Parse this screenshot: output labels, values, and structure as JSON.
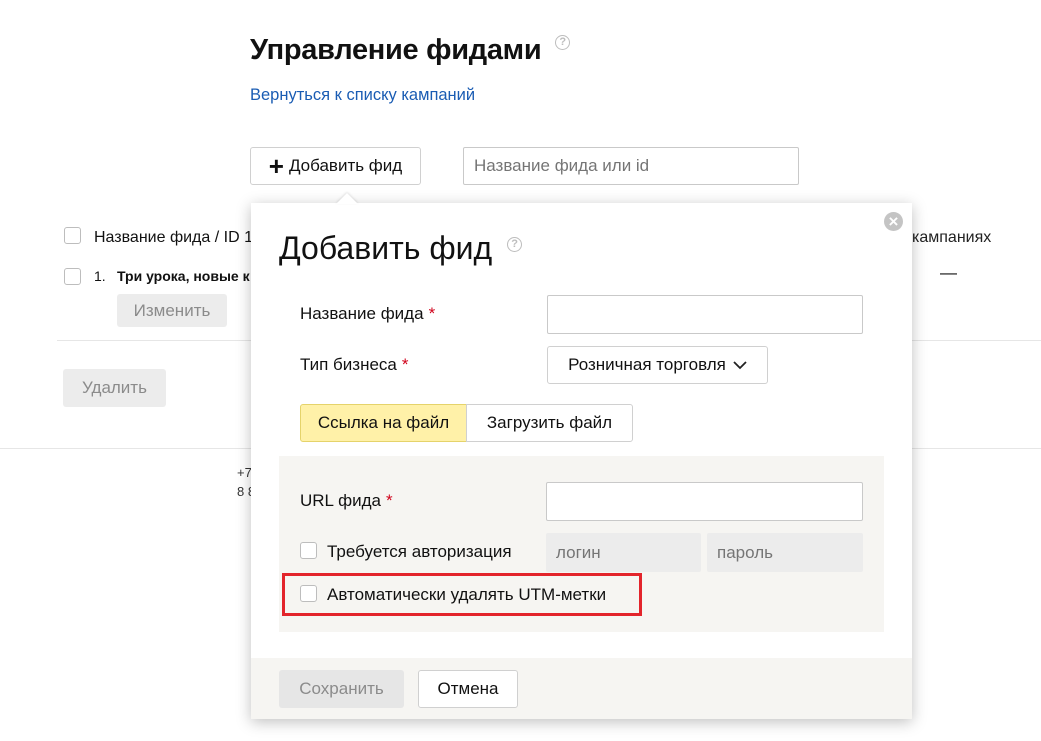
{
  "header": {
    "title": "Управление фидами",
    "help_icon": "?",
    "back_link": "Вернуться к списку кампаний"
  },
  "toolbar": {
    "add_feed_icon": "+",
    "add_feed_label": "Добавить фид",
    "search_placeholder": "Название фида или id"
  },
  "table": {
    "columns": [
      "Название фида / ID 1",
      "кампаниях"
    ],
    "rows": [
      {
        "number": "1.",
        "name": "Три урока, новые к",
        "campaigns": "—",
        "edit_label": "Изменить"
      }
    ]
  },
  "actions": {
    "delete_label": "Удалить"
  },
  "footer_fragment": {
    "line1": "+7",
    "line2": "8 8"
  },
  "dialog": {
    "title": "Добавить фид",
    "help_icon": "?",
    "close_icon": "×",
    "required_mark": "*",
    "feed_name_label": "Название фида",
    "feed_name_value": "",
    "business_type_label": "Тип бизнеса",
    "business_type_value": "Розничная торговля",
    "source_tabs": [
      "Ссылка на файл",
      "Загрузить файл"
    ],
    "url_label": "URL фида",
    "url_value": "",
    "auth_label": "Требуется авторизация",
    "login_placeholder": "логин",
    "password_placeholder": "пароль",
    "utm_label": "Автоматически удалять UTM-метки",
    "save_label": "Сохранить",
    "cancel_label": "Отмена"
  },
  "colors": {
    "link": "#1a5cb3",
    "active_tab": "#fff1a8",
    "required": "#d0021b",
    "highlight_frame": "#e3242b"
  }
}
